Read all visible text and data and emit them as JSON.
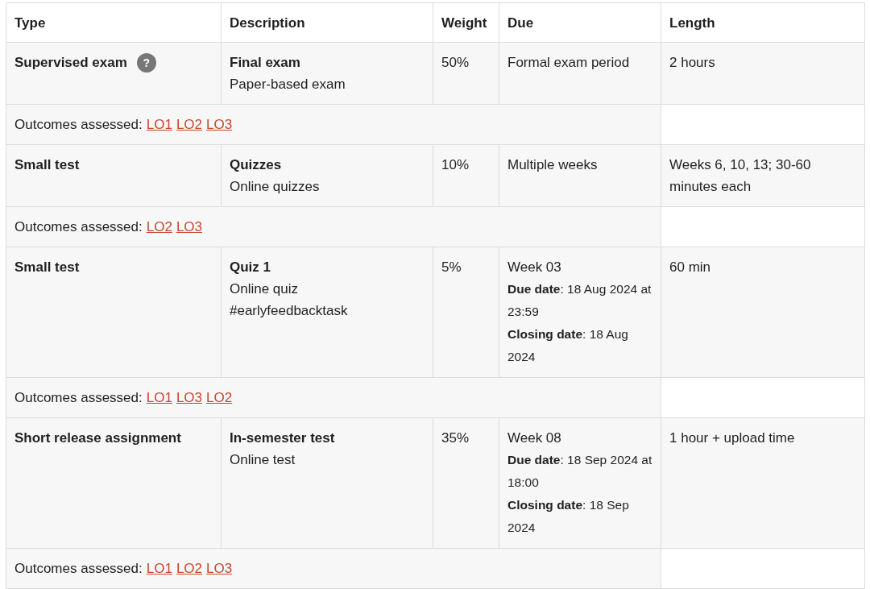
{
  "table": {
    "columns": [
      "Type",
      "Description",
      "Weight",
      "Due",
      "Length"
    ],
    "rows": [
      {
        "type": "Supervised exam",
        "help": "?",
        "title": "Final exam",
        "description": [
          "Paper-based exam"
        ],
        "weight": "50%",
        "due": "Formal exam period",
        "due_details": [],
        "length": "2 hours",
        "outcomes_label": "Outcomes assessed:",
        "outcomes": [
          "LO1",
          "LO2",
          "LO3"
        ]
      },
      {
        "type": "Small test",
        "title": "Quizzes",
        "description": [
          "Online quizzes"
        ],
        "weight": "10%",
        "due": "Multiple weeks",
        "due_details": [],
        "length": "Weeks 6, 10, 13; 30-60 minutes each",
        "outcomes_label": "Outcomes assessed:",
        "outcomes": [
          "LO2",
          "LO3"
        ]
      },
      {
        "type": "Small test",
        "title": "Quiz 1",
        "description": [
          "Online quiz",
          "#earlyfeedbacktask"
        ],
        "weight": "5%",
        "due": "Week 03",
        "due_details": [
          "**Due date**: 18 Aug 2024 at 23:59",
          "**Closing date**: 18 Aug 2024"
        ],
        "length": "60 min",
        "outcomes_label": "Outcomes assessed:",
        "outcomes": [
          "LO1",
          "LO3",
          "LO2"
        ]
      },
      {
        "type": "Short release assignment",
        "title": "In-semester test",
        "description": [
          "Online test"
        ],
        "weight": "35%",
        "due": "Week 08",
        "due_details": [
          "**Due date**: 18 Sep 2024 at 18:00",
          "**Closing date**: 18 Sep 2024"
        ],
        "length": "1 hour + upload time",
        "outcomes_label": "Outcomes assessed:",
        "outcomes": [
          "LO1",
          "LO2",
          "LO3"
        ]
      }
    ]
  }
}
